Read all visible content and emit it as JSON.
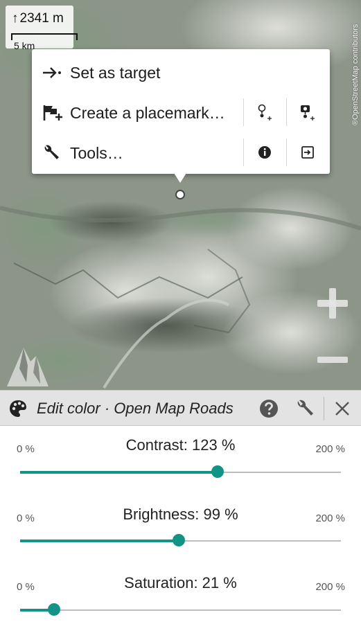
{
  "map": {
    "altitude": "2341 m",
    "scale": "5 km",
    "attribution": "®OpenStreetMap contributors"
  },
  "popup": {
    "items": [
      {
        "label": "Set as target",
        "icon": "arrow-target-icon"
      },
      {
        "label": "Create a placemark…",
        "icon": "flag-plus-icon"
      },
      {
        "label": "Tools…",
        "icon": "wrench-icon"
      }
    ],
    "placemark_actions": [
      "pin-plus-icon",
      "camera-pin-plus-icon"
    ],
    "tools_actions": [
      "info-icon",
      "exit-arrow-icon"
    ]
  },
  "zoom": {
    "in": "+",
    "out": "−"
  },
  "edit_bar": {
    "title": "Edit color · Open Map Roads",
    "icons": [
      "palette-icon",
      "help-icon",
      "wrench-icon",
      "close-icon"
    ]
  },
  "sliders": [
    {
      "label": "Contrast: 123 %",
      "min": "0 %",
      "max": "200 %",
      "value": 123,
      "max_value": 200
    },
    {
      "label": "Brightness: 99 %",
      "min": "0 %",
      "max": "200 %",
      "value": 99,
      "max_value": 200
    },
    {
      "label": "Saturation: 21 %",
      "min": "0 %",
      "max": "200 %",
      "value": 21,
      "max_value": 200
    }
  ],
  "colors": {
    "accent": "#139286",
    "bar": "#e3e3e3"
  }
}
